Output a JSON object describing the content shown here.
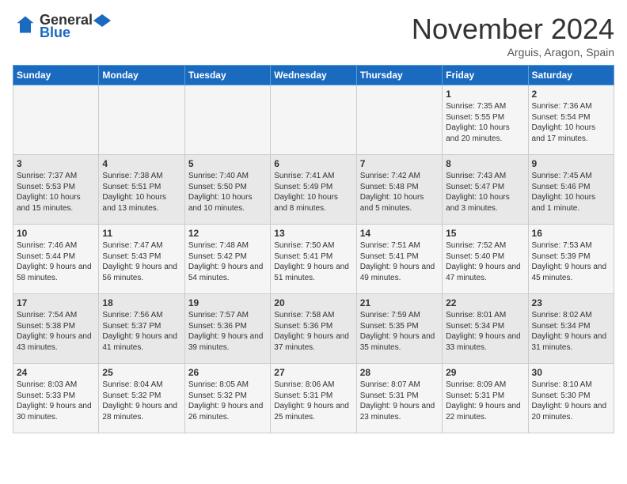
{
  "header": {
    "logo_line1": "General",
    "logo_line2": "Blue",
    "month": "November 2024",
    "location": "Arguis, Aragon, Spain"
  },
  "weekdays": [
    "Sunday",
    "Monday",
    "Tuesday",
    "Wednesday",
    "Thursday",
    "Friday",
    "Saturday"
  ],
  "weeks": [
    [
      {
        "day": "",
        "text": ""
      },
      {
        "day": "",
        "text": ""
      },
      {
        "day": "",
        "text": ""
      },
      {
        "day": "",
        "text": ""
      },
      {
        "day": "",
        "text": ""
      },
      {
        "day": "1",
        "text": "Sunrise: 7:35 AM\nSunset: 5:55 PM\nDaylight: 10 hours and 20 minutes."
      },
      {
        "day": "2",
        "text": "Sunrise: 7:36 AM\nSunset: 5:54 PM\nDaylight: 10 hours and 17 minutes."
      }
    ],
    [
      {
        "day": "3",
        "text": "Sunrise: 7:37 AM\nSunset: 5:53 PM\nDaylight: 10 hours and 15 minutes."
      },
      {
        "day": "4",
        "text": "Sunrise: 7:38 AM\nSunset: 5:51 PM\nDaylight: 10 hours and 13 minutes."
      },
      {
        "day": "5",
        "text": "Sunrise: 7:40 AM\nSunset: 5:50 PM\nDaylight: 10 hours and 10 minutes."
      },
      {
        "day": "6",
        "text": "Sunrise: 7:41 AM\nSunset: 5:49 PM\nDaylight: 10 hours and 8 minutes."
      },
      {
        "day": "7",
        "text": "Sunrise: 7:42 AM\nSunset: 5:48 PM\nDaylight: 10 hours and 5 minutes."
      },
      {
        "day": "8",
        "text": "Sunrise: 7:43 AM\nSunset: 5:47 PM\nDaylight: 10 hours and 3 minutes."
      },
      {
        "day": "9",
        "text": "Sunrise: 7:45 AM\nSunset: 5:46 PM\nDaylight: 10 hours and 1 minute."
      }
    ],
    [
      {
        "day": "10",
        "text": "Sunrise: 7:46 AM\nSunset: 5:44 PM\nDaylight: 9 hours and 58 minutes."
      },
      {
        "day": "11",
        "text": "Sunrise: 7:47 AM\nSunset: 5:43 PM\nDaylight: 9 hours and 56 minutes."
      },
      {
        "day": "12",
        "text": "Sunrise: 7:48 AM\nSunset: 5:42 PM\nDaylight: 9 hours and 54 minutes."
      },
      {
        "day": "13",
        "text": "Sunrise: 7:50 AM\nSunset: 5:41 PM\nDaylight: 9 hours and 51 minutes."
      },
      {
        "day": "14",
        "text": "Sunrise: 7:51 AM\nSunset: 5:41 PM\nDaylight: 9 hours and 49 minutes."
      },
      {
        "day": "15",
        "text": "Sunrise: 7:52 AM\nSunset: 5:40 PM\nDaylight: 9 hours and 47 minutes."
      },
      {
        "day": "16",
        "text": "Sunrise: 7:53 AM\nSunset: 5:39 PM\nDaylight: 9 hours and 45 minutes."
      }
    ],
    [
      {
        "day": "17",
        "text": "Sunrise: 7:54 AM\nSunset: 5:38 PM\nDaylight: 9 hours and 43 minutes."
      },
      {
        "day": "18",
        "text": "Sunrise: 7:56 AM\nSunset: 5:37 PM\nDaylight: 9 hours and 41 minutes."
      },
      {
        "day": "19",
        "text": "Sunrise: 7:57 AM\nSunset: 5:36 PM\nDaylight: 9 hours and 39 minutes."
      },
      {
        "day": "20",
        "text": "Sunrise: 7:58 AM\nSunset: 5:36 PM\nDaylight: 9 hours and 37 minutes."
      },
      {
        "day": "21",
        "text": "Sunrise: 7:59 AM\nSunset: 5:35 PM\nDaylight: 9 hours and 35 minutes."
      },
      {
        "day": "22",
        "text": "Sunrise: 8:01 AM\nSunset: 5:34 PM\nDaylight: 9 hours and 33 minutes."
      },
      {
        "day": "23",
        "text": "Sunrise: 8:02 AM\nSunset: 5:34 PM\nDaylight: 9 hours and 31 minutes."
      }
    ],
    [
      {
        "day": "24",
        "text": "Sunrise: 8:03 AM\nSunset: 5:33 PM\nDaylight: 9 hours and 30 minutes."
      },
      {
        "day": "25",
        "text": "Sunrise: 8:04 AM\nSunset: 5:32 PM\nDaylight: 9 hours and 28 minutes."
      },
      {
        "day": "26",
        "text": "Sunrise: 8:05 AM\nSunset: 5:32 PM\nDaylight: 9 hours and 26 minutes."
      },
      {
        "day": "27",
        "text": "Sunrise: 8:06 AM\nSunset: 5:31 PM\nDaylight: 9 hours and 25 minutes."
      },
      {
        "day": "28",
        "text": "Sunrise: 8:07 AM\nSunset: 5:31 PM\nDaylight: 9 hours and 23 minutes."
      },
      {
        "day": "29",
        "text": "Sunrise: 8:09 AM\nSunset: 5:31 PM\nDaylight: 9 hours and 22 minutes."
      },
      {
        "day": "30",
        "text": "Sunrise: 8:10 AM\nSunset: 5:30 PM\nDaylight: 9 hours and 20 minutes."
      }
    ]
  ]
}
